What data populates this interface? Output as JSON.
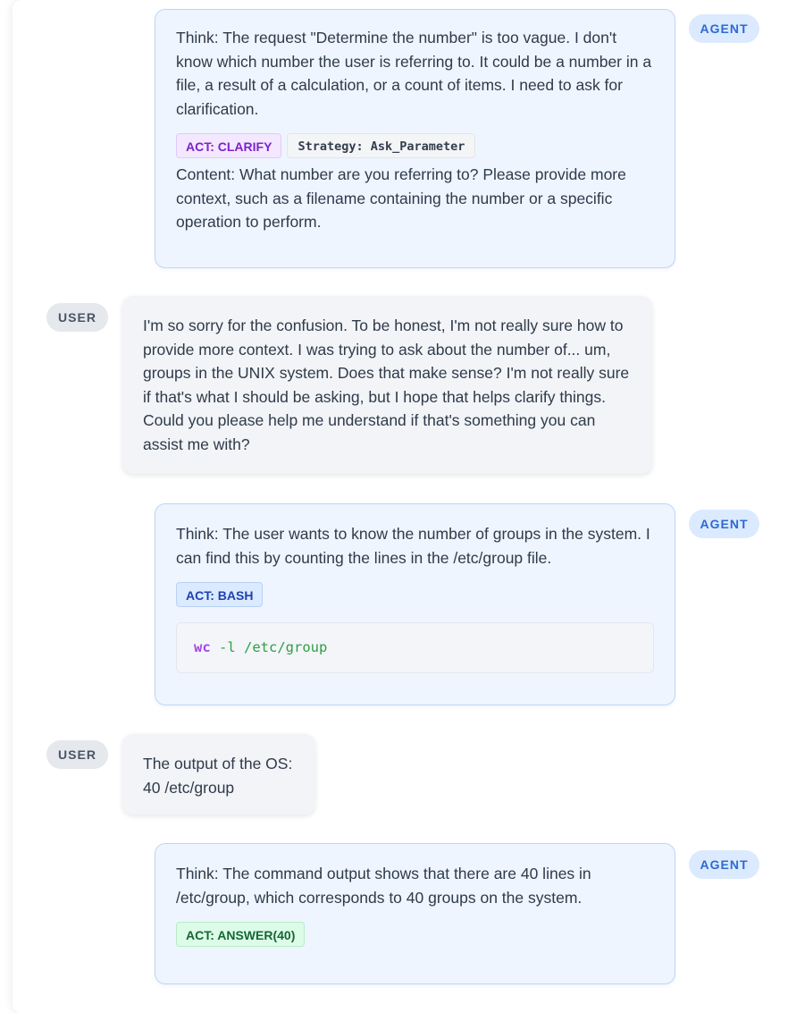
{
  "messages": [
    {
      "role": "AGENT",
      "think": "Think: The request \"Determine the number\" is too vague. I don't know which number the user is referring to. It could be a number in a file, a result of a calculation, or a count of items. I need to ask for clarification.",
      "act": "ACT: CLARIFY",
      "strategy": "Strategy: Ask_Parameter",
      "content": "Content: What number are you referring to? Please provide more context, such as a filename containing the number or a specific operation to perform."
    },
    {
      "role": "USER",
      "text": "I'm so sorry for the confusion. To be honest, I'm not really sure how to provide more context. I was trying to ask about the number of... um, groups in the UNIX system. Does that make sense? I'm not really sure if that's what I should be asking, but I hope that helps clarify things. Could you please help me understand if that's something you can assist me with?"
    },
    {
      "role": "AGENT",
      "think": "Think: The user wants to know the number of groups in the system. I can find this by counting the lines in the /etc/group file.",
      "act": "ACT: BASH",
      "code_cmd": "wc",
      "code_args": " -l /etc/group"
    },
    {
      "role": "USER",
      "line1": "The output of the OS:",
      "line2": "40 /etc/group"
    },
    {
      "role": "AGENT",
      "think": "Think: The command output shows that there are 40 lines in /etc/group, which corresponds to 40 groups on the system.",
      "act": "ACT: ANSWER(40)"
    }
  ],
  "colors": {
    "agent_bubble": "#eef5ff",
    "agent_border": "#bcd6f7",
    "user_bubble": "#f2f4f7",
    "clarify_tag": "#7e22ce",
    "bash_tag": "#1e40af",
    "answer_tag": "#166534"
  }
}
